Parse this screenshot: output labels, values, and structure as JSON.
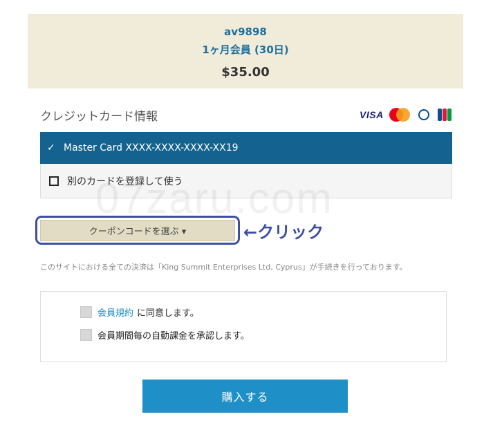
{
  "order": {
    "username": "av9898",
    "plan": "1ヶ月会員 (30日)",
    "price": "$35.00"
  },
  "credit_card": {
    "heading": "クレジットカード情報",
    "logos": [
      "visa",
      "mastercard",
      "diners-club",
      "jcb"
    ],
    "visa_text": "VISA",
    "saved_card": "Master Card XXXX-XXXX-XXXX-XX19",
    "selected_icon": "✓",
    "other_card_label": "別のカードを登録して使う"
  },
  "watermark": "07zaru.com",
  "coupon": {
    "button_label": "クーポンコードを選ぶ ▾",
    "annotation": "←クリック"
  },
  "notice": "このサイトにおける全ての決済は「King Summit Enterprises Ltd, Cyprus」が手続きを行っております。",
  "agreements": {
    "terms_link": "会員規約",
    "terms_suffix": "に同意します。",
    "auto_billing": "会員期間毎の自動課金を承認します。"
  },
  "purchase_button": "購入する",
  "colors": {
    "summary_bg": "#f1ecda",
    "selected_card_bg": "#13628f",
    "accent_blue": "#1d6f9e",
    "buy_button": "#1f8fc8",
    "annotation": "#3b4fa6"
  }
}
